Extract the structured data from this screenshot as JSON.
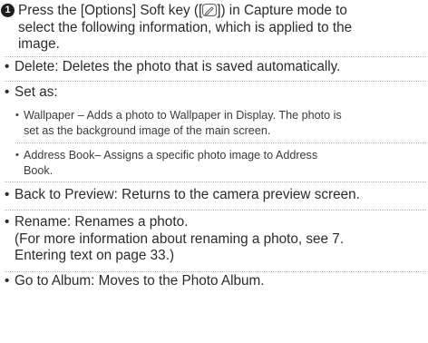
{
  "step": {
    "number": "1",
    "line1_prefix": "Press the [Options] Soft key ([",
    "line1_suffix": "]) in Capture mode to",
    "line2": "select the following information, which is applied to the",
    "line3": "image.",
    "key_icon": "pen-key-icon"
  },
  "bullet_char": "•",
  "items": {
    "delete": "Delete: Deletes the photo that is saved automatically.",
    "set_as": "Set as:",
    "wallpaper_line1": "Wallpaper – Adds a photo to Wallpaper in Display. The photo is",
    "wallpaper_line2": "set as the background image of the main screen.",
    "address_line1": "Address Book– Assigns a specific photo image to Address",
    "address_line2": "Book.",
    "back": "Back to Preview: Returns to the camera preview screen.",
    "rename_line1": "Rename: Renames a photo.",
    "rename_line2": "(For more information about renaming a photo, see 7.",
    "rename_line3": "Entering text on page 33.)",
    "album": "Go to Album: Moves to the Photo Album."
  },
  "colors": {
    "text": "#2b2b2b",
    "divider": "#b5b5b5",
    "step_badge": "#1e1e1e"
  }
}
